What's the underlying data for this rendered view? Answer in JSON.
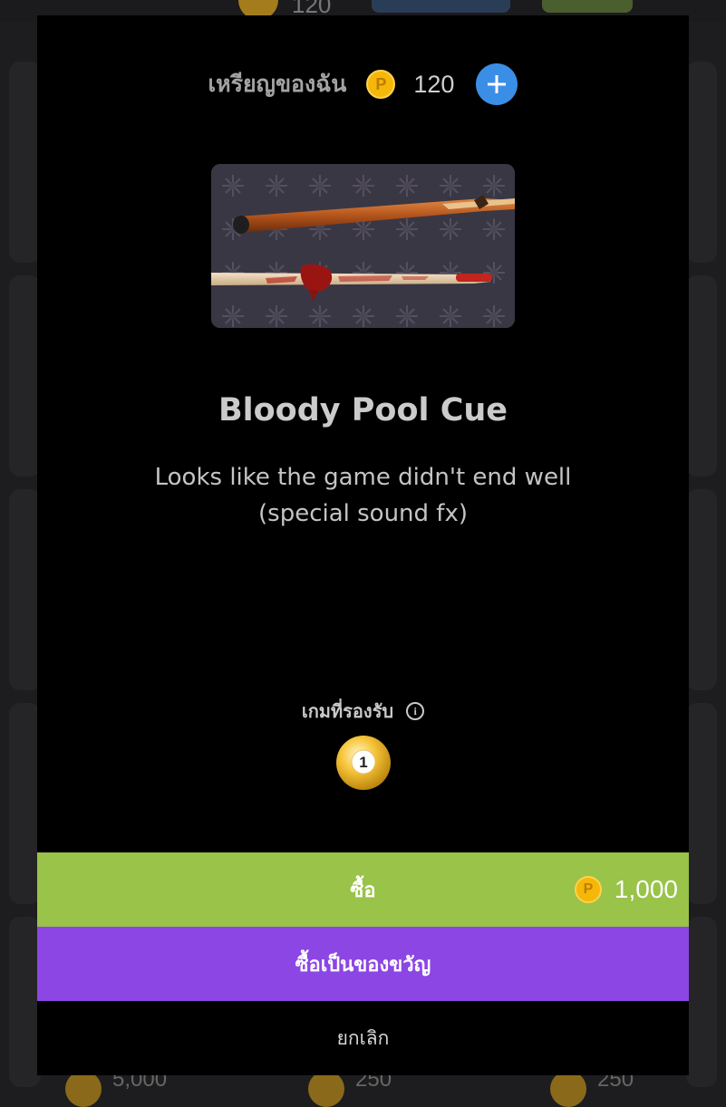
{
  "background": {
    "coin_count": "120",
    "bottom_prices": [
      "5,000",
      "250",
      "250"
    ]
  },
  "modal": {
    "coin_label": "เหรียญของฉัน",
    "coin_count": "120",
    "item": {
      "title": "Bloody Pool Cue",
      "description_line1": "Looks like the game didn't end well",
      "description_line2": "(special sound fx)"
    },
    "supported_games_label": "เกมที่รองรับ",
    "supported_game_ball_number": "1",
    "buy_label": "ซื้อ",
    "buy_price": "1,000",
    "gift_label": "ซื้อเป็นของขวัญ",
    "cancel_label": "ยกเลิก"
  },
  "icons": {
    "coin": "coin-icon",
    "plus": "plus-icon",
    "info": "info-icon",
    "ball": "billiard-ball-1-icon"
  },
  "colors": {
    "modal_bg": "#000000",
    "buy_button": "#99c349",
    "gift_button": "#8c46e4",
    "plus_button": "#3b8ee6",
    "coin": "#f4b70a"
  }
}
